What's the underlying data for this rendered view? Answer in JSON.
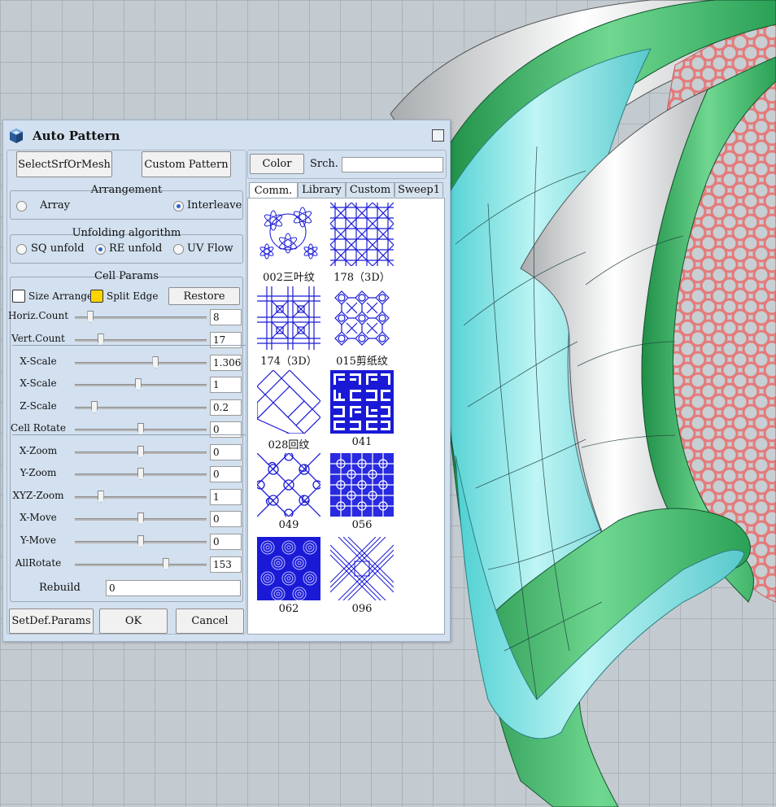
{
  "dialog": {
    "title": "Auto Pattern"
  },
  "toolbar": {
    "select_label": "SelectSrfOrMesh",
    "custom_pattern_label": "Custom Pattern",
    "color_label": "Color",
    "search_label": "Srch.",
    "search_value": ""
  },
  "arrangement": {
    "title": "Arrangement",
    "options": [
      "Array",
      "Interleave"
    ],
    "selected": "Interleave"
  },
  "unfolding": {
    "title": "Unfolding algorithm",
    "options": [
      "SQ unfold",
      "RE unfold",
      "UV Flow"
    ],
    "selected": "RE unfold"
  },
  "cell_params": {
    "title": "Cell Params",
    "size_arrange_label": "Size Arrange",
    "size_arrange_checked": false,
    "split_edge_label": "Split Edge",
    "split_edge_checked": true,
    "split_edge_color": "#ffd400",
    "restore_label": "Restore",
    "params": [
      {
        "label": "Horiz.Count",
        "value": "8",
        "level": 0.1
      },
      {
        "label": "Vert.Count",
        "value": "17",
        "level": 0.18
      },
      {
        "label": "X-Scale",
        "value": "1.306",
        "level": 0.62
      },
      {
        "label": "X-Scale",
        "value": "1",
        "level": 0.48
      },
      {
        "label": "Z-Scale",
        "value": "0.2",
        "level": 0.13
      },
      {
        "label": "Cell Rotate",
        "value": "0",
        "level": 0.5
      },
      {
        "label": "X-Zoom",
        "value": "0",
        "level": 0.5
      },
      {
        "label": "Y-Zoom",
        "value": "0",
        "level": 0.5
      },
      {
        "label": "XYZ-Zoom",
        "value": "1",
        "level": 0.18
      },
      {
        "label": "X-Move",
        "value": "0",
        "level": 0.5
      },
      {
        "label": "Y-Move",
        "value": "0",
        "level": 0.5
      },
      {
        "label": "AllRotate",
        "value": "153",
        "level": 0.7
      }
    ],
    "rebuild_label": "Rebuild",
    "rebuild_value": "0"
  },
  "bottom": {
    "setdef_label": "SetDef.Params",
    "ok_label": "OK",
    "cancel_label": "Cancel"
  },
  "tabs": [
    "Comm.",
    "Library",
    "Custom",
    "Sweep1"
  ],
  "active_tab": "Comm.",
  "patterns": [
    {
      "label": "002三叶纹",
      "icon": "trefoil-pattern-icon"
    },
    {
      "label": "178（3D）",
      "icon": "grid-circle-pattern-icon"
    },
    {
      "label": "174（3D）",
      "icon": "lattice-pattern-icon"
    },
    {
      "label": "015剪纸纹",
      "icon": "papercut-pattern-icon"
    },
    {
      "label": "028回纹",
      "icon": "weave-pattern-icon"
    },
    {
      "label": "041",
      "icon": "fret-pattern-icon"
    },
    {
      "label": "049",
      "icon": "quatrefoil-pattern-icon"
    },
    {
      "label": "056",
      "icon": "knot-grid-pattern-icon"
    },
    {
      "label": "062",
      "icon": "swirl-pattern-icon"
    },
    {
      "label": "096",
      "icon": "basket-weave-pattern-icon"
    }
  ],
  "colors": {
    "pattern_blue": "#1a1ad6",
    "dialog_bg": "#d2e0ef",
    "surface_cyan": "#7fe3e3",
    "surface_green": "#3fb86a",
    "mesh_pink": "#e88080"
  }
}
